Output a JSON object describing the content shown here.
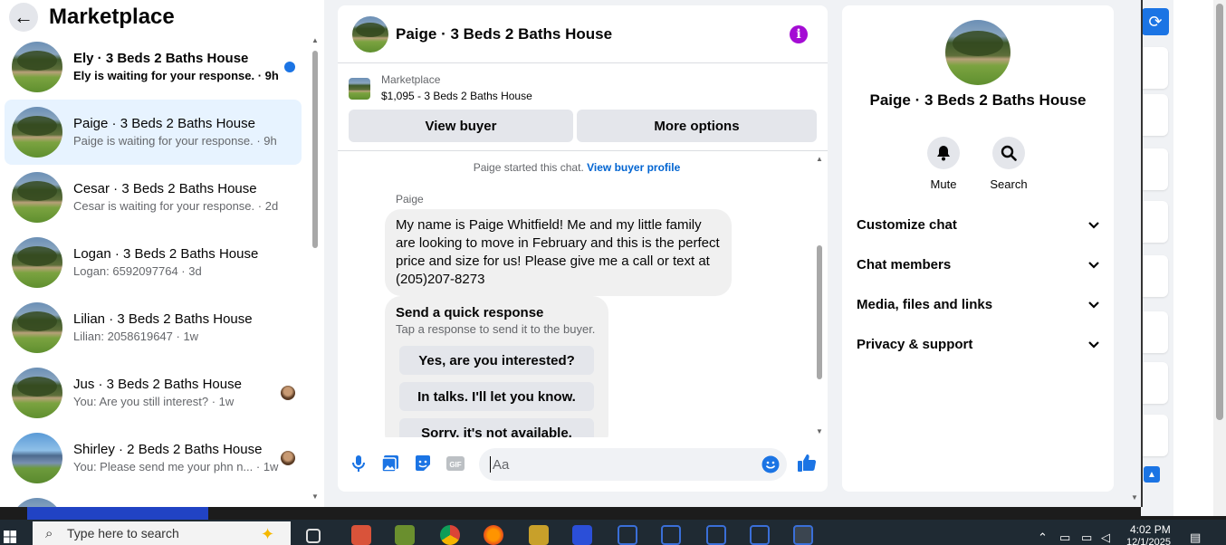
{
  "left": {
    "title": "Marketplace",
    "conversations": [
      {
        "name": "Ely · 3 Beds 2 Baths House",
        "message": "Ely is waiting for your response.",
        "time": "9h"
      },
      {
        "name": "Paige · 3 Beds 2 Baths House",
        "message": "Paige is waiting for your response.",
        "time": "9h"
      },
      {
        "name": "Cesar · 3 Beds 2 Baths House",
        "message": "Cesar is waiting for your response.",
        "time": "2d"
      },
      {
        "name": "Logan · 3 Beds 2 Baths House",
        "message": "Logan: 6592097764",
        "time": "3d"
      },
      {
        "name": "Lilian · 3 Beds 2 Baths House",
        "message": "Lilian: 2058619647",
        "time": "1w"
      },
      {
        "name": "Jus · 3 Beds 2 Baths House",
        "message": "You: Are you still interest?",
        "time": "1w"
      },
      {
        "name": "Shirley · 2 Beds 2 Baths House",
        "message": "You: Please send me your phn n...",
        "time": "1w"
      }
    ]
  },
  "chat": {
    "title": "Paige · 3 Beds 2 Baths House",
    "listing_label": "Marketplace",
    "listing_price": "$1,095 - 3 Beds 2 Baths House",
    "view_buyer": "View buyer",
    "more_options": "More options",
    "started_text": "Paige started this chat.",
    "view_buyer_profile": "View buyer profile",
    "sender": "Paige",
    "message": "My name is Paige Whitfield! Me and my little family are looking to move in February and this is the perfect price and size for us! Please give me a call or text at (205)207-8273",
    "quick_title": "Send a quick response",
    "quick_subtitle": "Tap a response to send it to the buyer.",
    "quick_replies": [
      "Yes, are you interested?",
      "In talks. I'll let you know.",
      "Sorry, it's not available."
    ],
    "input_placeholder": "Aa",
    "gif_label": "GIF"
  },
  "details": {
    "title": "Paige · 3 Beds 2 Baths House",
    "mute": "Mute",
    "search": "Search",
    "sections": [
      "Customize chat",
      "Chat members",
      "Media, files and links",
      "Privacy & support"
    ]
  },
  "taskbar": {
    "search_placeholder": "Type here to search",
    "time": "4:02 PM",
    "date": "12/1/2025"
  },
  "colors": {
    "accent": "#1b74e4",
    "selected_bg": "#e7f3ff",
    "info_purple": "#a40cd4"
  }
}
